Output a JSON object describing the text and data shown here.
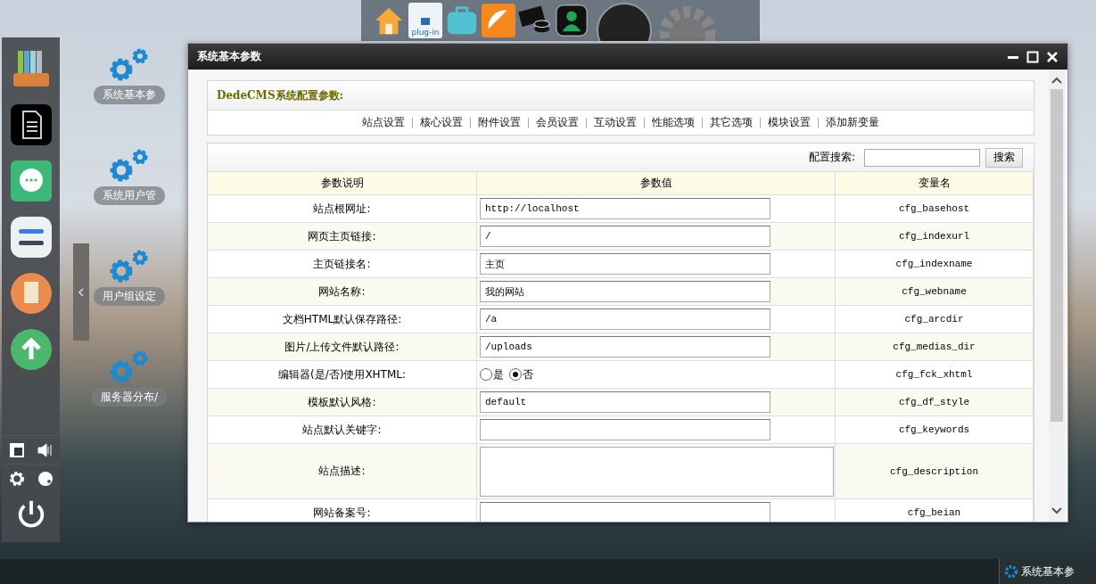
{
  "desktop_icons": [
    {
      "label": "系统基本参"
    },
    {
      "label": "系统用户管"
    },
    {
      "label": "用户组设定"
    },
    {
      "label": "服务器分布/"
    }
  ],
  "top_dock": {
    "plugin_label": "plug-in"
  },
  "window": {
    "title": "系统基本参数"
  },
  "panel_title": "DedeCMS系统配置参数:",
  "nav_links": [
    "站点设置",
    "核心设置",
    "附件设置",
    "会员设置",
    "互动设置",
    "性能选项",
    "其它选项",
    "模块设置",
    "添加新变量"
  ],
  "search": {
    "label": "配置搜索:",
    "button": "搜索"
  },
  "columns": [
    "参数说明",
    "参数值",
    "变量名"
  ],
  "rows": [
    {
      "label": "站点根网址:",
      "kind": "text",
      "value": "http://localhost",
      "var": "cfg_basehost"
    },
    {
      "label": "网页主页链接:",
      "kind": "text",
      "value": "/",
      "var": "cfg_indexurl"
    },
    {
      "label": "主页链接名:",
      "kind": "text",
      "value": "主页",
      "var": "cfg_indexname"
    },
    {
      "label": "网站名称:",
      "kind": "text",
      "value": "我的网站",
      "var": "cfg_webname"
    },
    {
      "label": "文档HTML默认保存路径:",
      "kind": "text",
      "value": "/a",
      "var": "cfg_arcdir"
    },
    {
      "label": "图片/上传文件默认路径:",
      "kind": "text",
      "value": "/uploads",
      "var": "cfg_medias_dir"
    },
    {
      "label": "编辑器(是/否)使用XHTML:",
      "kind": "radio",
      "options": [
        {
          "label": "是",
          "selected": false
        },
        {
          "label": "否",
          "selected": true
        }
      ],
      "var": "cfg_fck_xhtml"
    },
    {
      "label": "模板默认风格:",
      "kind": "text",
      "value": "default",
      "var": "cfg_df_style"
    },
    {
      "label": "站点默认关键字:",
      "kind": "text",
      "value": "",
      "var": "cfg_keywords"
    },
    {
      "label": "站点描述:",
      "kind": "textarea",
      "value": "",
      "var": "cfg_description"
    },
    {
      "label": "网站备案号:",
      "kind": "text",
      "value": "",
      "var": "cfg_beian"
    }
  ],
  "taskbar": {
    "item": "系统基本参"
  }
}
